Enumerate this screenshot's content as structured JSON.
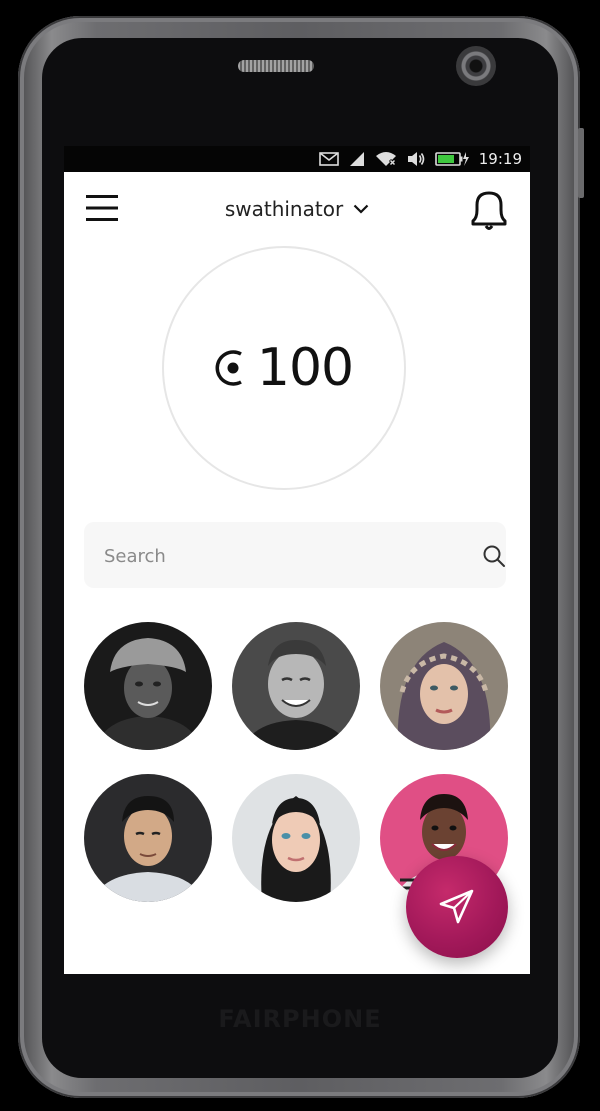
{
  "device": {
    "brand_text": "FAIRPHONE"
  },
  "status_bar": {
    "time": "19:19",
    "icons": [
      "mail-icon",
      "cell-signal-icon",
      "wifi-icon",
      "volume-icon",
      "battery-charging-icon"
    ]
  },
  "app_bar": {
    "menu_icon": "hamburger-menu-icon",
    "account_name": "swathinator",
    "account_chevron_icon": "chevron-down-icon",
    "notifications_icon": "bell-icon"
  },
  "balance": {
    "currency_icon": "coin-currency-icon",
    "amount": "100"
  },
  "search": {
    "placeholder": "Search",
    "value": "",
    "icon": "search-icon"
  },
  "contacts": {
    "avatars": [
      {
        "icon": "avatar-photo-man-bucket-hat",
        "tone": "grayscale"
      },
      {
        "icon": "avatar-photo-smiling-man",
        "tone": "grayscale"
      },
      {
        "icon": "avatar-photo-woman-headscarf",
        "tone": "color"
      },
      {
        "icon": "avatar-photo-man-white-shirt",
        "tone": "color"
      },
      {
        "icon": "avatar-photo-woman-braids",
        "tone": "color"
      },
      {
        "icon": "avatar-photo-woman-pink-background",
        "tone": "color"
      }
    ]
  },
  "fab": {
    "icon": "send-paper-plane-icon"
  },
  "colors": {
    "accent": "#a3195a",
    "status_bar_bg": "#050505",
    "screen_bg": "#ffffff",
    "search_bg": "#f7f7f7",
    "circle_border": "#e6e6e6"
  }
}
